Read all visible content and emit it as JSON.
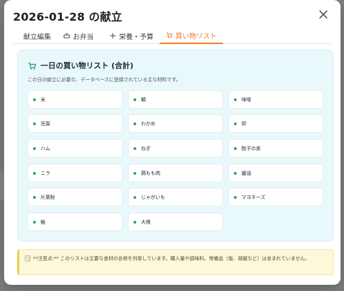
{
  "modal": {
    "title": "2026-01-28 の献立",
    "close_label": "×"
  },
  "tabs": [
    {
      "label": "献立編集",
      "icon": "none",
      "active": false
    },
    {
      "label": "お弁当",
      "icon": "bento-icon",
      "active": false
    },
    {
      "label": "栄養・予算",
      "icon": "plus-icon",
      "active": false
    },
    {
      "label": "買い物リスト",
      "icon": "cart-icon",
      "active": true
    }
  ],
  "shopping": {
    "title": "一日の買い物リスト (合計)",
    "description": "この日の献立に必要な、データベースに登録されている主な材料です。",
    "items": [
      "米",
      "鯖",
      "味噌",
      "豆腐",
      "わかめ",
      "卵",
      "ハム",
      "ねぎ",
      "餃子の皮",
      "ニラ",
      "鶏もも肉",
      "醤油",
      "片栗粉",
      "じゃがいも",
      "マヨネーズ",
      "鮭",
      "大根"
    ]
  },
  "note": {
    "text": "**注意点:** このリストは主要な食材の名称を列挙しています。購入量や調味料、常備品（塩、胡椒など）は含まれていません。"
  },
  "colors": {
    "accent": "#f07a2f",
    "panel_bg": "#e9f8fb",
    "bullet": "#2f9e6b",
    "note_bg": "#fdf8d9"
  }
}
